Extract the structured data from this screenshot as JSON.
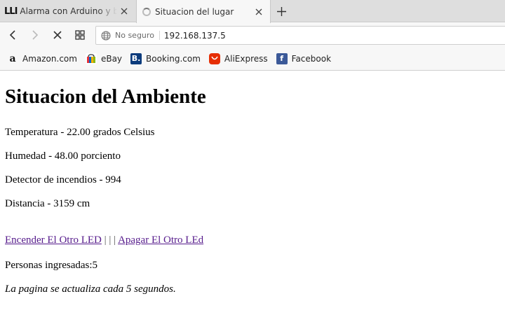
{
  "browser": {
    "tabs": [
      {
        "title": "Alarma con Arduino y buzzer",
        "icon": "lll-favicon-icon"
      },
      {
        "title": "Situacion del lugar",
        "icon": "loading-spinner-icon",
        "active": true
      }
    ],
    "address": {
      "security_label": "No seguro",
      "url": "192.168.137.5"
    },
    "bookmarks": [
      {
        "label": "Amazon.com",
        "icon": "amazon-icon"
      },
      {
        "label": "eBay",
        "icon": "ebay-icon"
      },
      {
        "label": "Booking.com",
        "icon": "booking-icon"
      },
      {
        "label": "AliExpress",
        "icon": "aliexpress-icon"
      },
      {
        "label": "Facebook",
        "icon": "facebook-icon"
      }
    ]
  },
  "page": {
    "heading": "Situacion del Ambiente",
    "readings": [
      "Temperatura - 22.00 grados Celsius",
      "Humedad - 48.00 porciento",
      "Detector de incendios - 994",
      "Distancia - 3159 cm"
    ],
    "links": {
      "on_label": "Encender El Otro LED",
      "separator": " | | | ",
      "off_label": "Apagar El Otro LEd"
    },
    "persons": "Personas ingresadas:5",
    "refresh_note": "La pagina se actualiza cada 5 segundos."
  },
  "colors": {
    "visited_link": "#551a8b",
    "tabstrip": "#dedede",
    "toolbar": "#f7f7f7"
  }
}
